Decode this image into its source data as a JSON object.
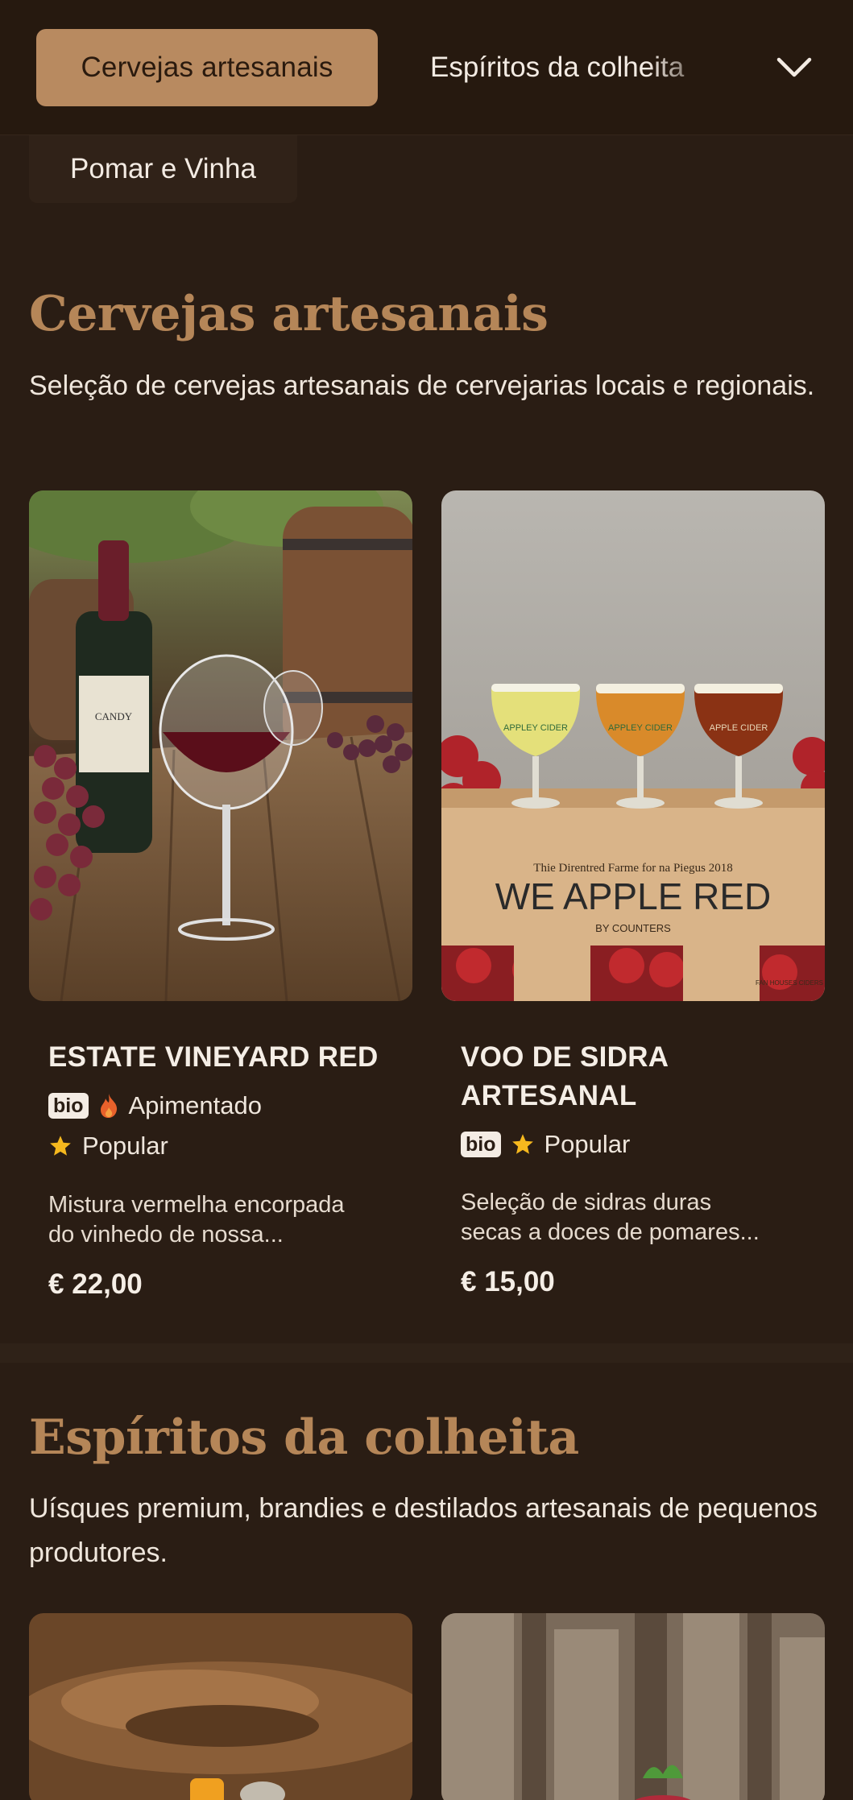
{
  "nav": {
    "active_tab": "Cervejas artesanais",
    "next_tab": "Espíritos da colheita",
    "second_row_tab": "Pomar e Vinha",
    "toggle_icon": "chevron-down-icon"
  },
  "sections": [
    {
      "title": "Cervejas artesanais",
      "description": "Seleção de cervejas artesanais de cervejarias locais e regionais.",
      "products": [
        {
          "name": "ESTATE VINEYARD RED",
          "badge": "bio",
          "spicy_label": "Apimentado",
          "popular_label": "Popular",
          "description_line1": "Mistura vermelha encorpada",
          "description_line2": "do vinhedo de nossa...",
          "price": "€ 22,00"
        },
        {
          "name_line1": "VOO DE SIDRA",
          "name_line2": "ARTESANAL",
          "badge": "bio",
          "popular_label": "Popular",
          "description_line1": "Seleção de sidras duras",
          "description_line2": "secas a doces de pomares...",
          "price": "€ 15,00",
          "image_text": {
            "glass1": "APPLEY CIDER",
            "glass2": "APPLEY CIDER",
            "glass3": "APPLE CIDER",
            "crate_small": "Thie Direntred Farme for na Piegus 2018",
            "crate_big": "WE APPLE RED",
            "crate_sub": "BY COUNTERS",
            "crate_corner": "FAN HOUSES CIDERS"
          }
        }
      ]
    },
    {
      "title": "Espíritos da colheita",
      "description": "Uísques premium, brandies e destilados artesanais de pequenos produtores."
    }
  ],
  "colors": {
    "background": "#2a1d14",
    "accent": "#b88a60",
    "heading": "#b58658",
    "star": "#f5b81e",
    "flame": "#e8612b"
  }
}
